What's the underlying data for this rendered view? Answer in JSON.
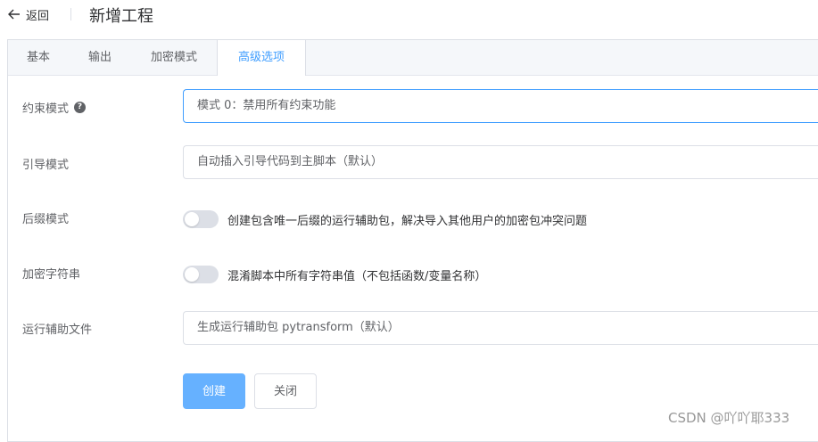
{
  "header": {
    "back_label": "返回",
    "title": "新增工程"
  },
  "tabs": [
    {
      "label": "基本"
    },
    {
      "label": "输出"
    },
    {
      "label": "加密模式"
    },
    {
      "label": "高级选项",
      "active": true
    }
  ],
  "form": {
    "constraint_mode": {
      "label": "约束模式",
      "value": "模式 0：禁用所有约束功能"
    },
    "bootstrap_mode": {
      "label": "引导模式",
      "value": "自动插入引导代码到主脚本（默认）"
    },
    "suffix_mode": {
      "label": "后缀模式",
      "switch_text": "创建包含唯一后缀的运行辅助包，解决导入其他用户的加密包冲突问题",
      "enabled": false
    },
    "encrypt_strings": {
      "label": "加密字符串",
      "switch_text": "混淆脚本中所有字符串值（不包括函数/变量名称）",
      "enabled": false
    },
    "runtime_file": {
      "label": "运行辅助文件",
      "value": "生成运行辅助包 pytransform（默认）"
    }
  },
  "buttons": {
    "create": "创建",
    "close": "关闭"
  },
  "watermark": "CSDN @吖吖耶333",
  "colors": {
    "accent": "#409eff",
    "primary_button": "#66b1ff"
  },
  "icons": {
    "back": "arrow-left-icon",
    "help": "question-circle-icon"
  }
}
